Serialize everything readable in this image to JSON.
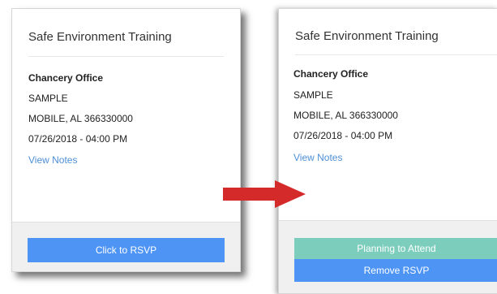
{
  "left_card": {
    "title": "Safe Environment Training",
    "location_name": "Chancery Office",
    "address_line": "SAMPLE",
    "city_state_zip": "MOBILE, AL 366330000",
    "datetime": "07/26/2018 - 04:00 PM",
    "notes_link": "View Notes",
    "rsvp_button": "Click to RSVP"
  },
  "right_card": {
    "title": "Safe Environment Training",
    "location_name": "Chancery Office",
    "address_line": "SAMPLE",
    "city_state_zip": "MOBILE, AL 366330000",
    "datetime": "07/26/2018 - 04:00 PM",
    "notes_link": "View Notes",
    "status_button": "Planning to Attend",
    "remove_button": "Remove RSVP"
  },
  "colors": {
    "arrow": "#d42a2a",
    "primary_button": "#4d94f5",
    "status_button": "#7ccdbb",
    "link": "#4f8fd6"
  },
  "icons": {
    "transition_arrow": "right-arrow-icon"
  }
}
